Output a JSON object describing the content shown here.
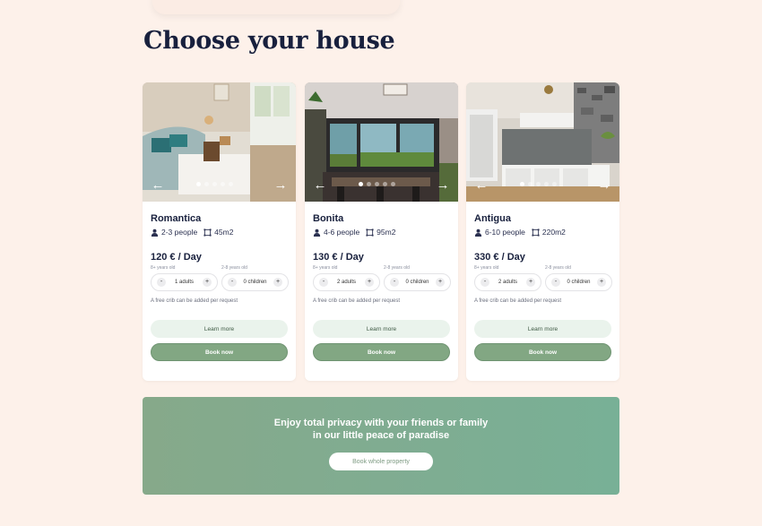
{
  "heading": "Choose your house",
  "houses": [
    {
      "name": "Romantica",
      "people": "2-3 people",
      "area": "45m2",
      "price": "120 € / Day",
      "adult_age": "8+ years old",
      "child_age": "2-8 years old",
      "adults": "1 adults",
      "children": "0 children",
      "minus": "-",
      "plus": "+",
      "crib_note": "A free crib can be added per request",
      "learn_label": "Learn more",
      "book_label": "Book now"
    },
    {
      "name": "Bonita",
      "people": "4-6 people",
      "area": "95m2",
      "price": "130 € / Day",
      "adult_age": "8+ years old",
      "child_age": "2-8 years old",
      "adults": "2 adults",
      "children": "0 children",
      "minus": "-",
      "plus": "+",
      "crib_note": "A free crib can be added per request",
      "learn_label": "Learn more",
      "book_label": "Book now"
    },
    {
      "name": "Antigua",
      "people": "6-10 people",
      "area": "220m2",
      "price": "330 € / Day",
      "adult_age": "8+ years old",
      "child_age": "2-8 years old",
      "adults": "2 adults",
      "children": "0 children",
      "minus": "-",
      "plus": "+",
      "crib_note": "A free crib can be added per request",
      "learn_label": "Learn more",
      "book_label": "Book now"
    }
  ],
  "carousel": {
    "prev_icon": "arrow-left-icon",
    "next_icon": "arrow-right-icon",
    "prev_glyph": "←",
    "next_glyph": "→"
  },
  "banner": {
    "line1": "Enjoy total privacy with your friends or family",
    "line2": "in our little peace of paradise",
    "button_label": "Book whole property"
  },
  "colors": {
    "background": "#fdf1ea",
    "title": "#18203d",
    "book_button": "#82a783",
    "learn_button": "#eaf3ec",
    "banner": "#80ac91"
  }
}
